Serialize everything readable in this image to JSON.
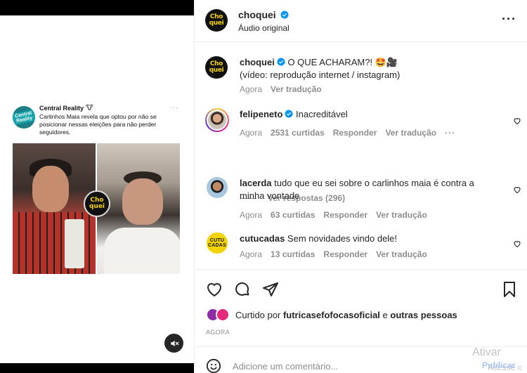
{
  "media": {
    "tweet": {
      "author": "Central Reality",
      "author_emoji": "🐮",
      "avatar_text": "Central Reality",
      "more": "···",
      "body": "Carlinhos Maia revela que optou por não se posicionar nessas eleições para não perder seguidores."
    },
    "badge_line1": "Cho",
    "badge_line2": "quei",
    "mute_icon": "speaker-muted-icon"
  },
  "header": {
    "avatar_line1": "Cho",
    "avatar_line2": "quei",
    "username": "choquei",
    "subtitle": "Áudio original",
    "more": "···"
  },
  "caption": {
    "username": "choquei",
    "text": " O QUE ACHARAM?! 🤩🎥",
    "text2": "(vídeo: reprodução internet / instagram)",
    "time": "Agora",
    "translate": "Ver tradução"
  },
  "comments": [
    {
      "username": "felipeneto",
      "verified": true,
      "text": " Inacreditável",
      "time": "Agora",
      "likes": "2531 curtidas",
      "reply": "Responder",
      "translate": "Ver tradução",
      "more": "···",
      "view_replies": "Ver respostas (296)"
    },
    {
      "username": "lacerda",
      "text": " tudo que eu sei sobre o carlinhos maia é contra a minha vontade",
      "time": "Agora",
      "likes": "63 curtidas",
      "reply": "Responder",
      "translate": "Ver tradução"
    },
    {
      "username": "cutucadas",
      "avatar_line1": "CUTU",
      "avatar_line2": "CADAS",
      "text": " Sem novidades vindo dele!",
      "time": "Agora",
      "likes": "13 curtidas",
      "reply": "Responder",
      "translate": "Ver tradução"
    }
  ],
  "actions": {
    "liked_prefix": "Curtido por ",
    "liked_user": "futricasefofocasoficial",
    "liked_mid": " e ",
    "liked_others": "outras pessoas",
    "time_caps": "AGORA"
  },
  "comment_box": {
    "placeholder": "Adicione um comentário...",
    "publish": "Publicar"
  },
  "overlay": {
    "activate": "Ativar",
    "access": "Acesse c"
  },
  "colors": {
    "brand_yellow": "#f4d100",
    "verified_blue": "#0095f6",
    "muted_text": "#8e8e8e"
  }
}
